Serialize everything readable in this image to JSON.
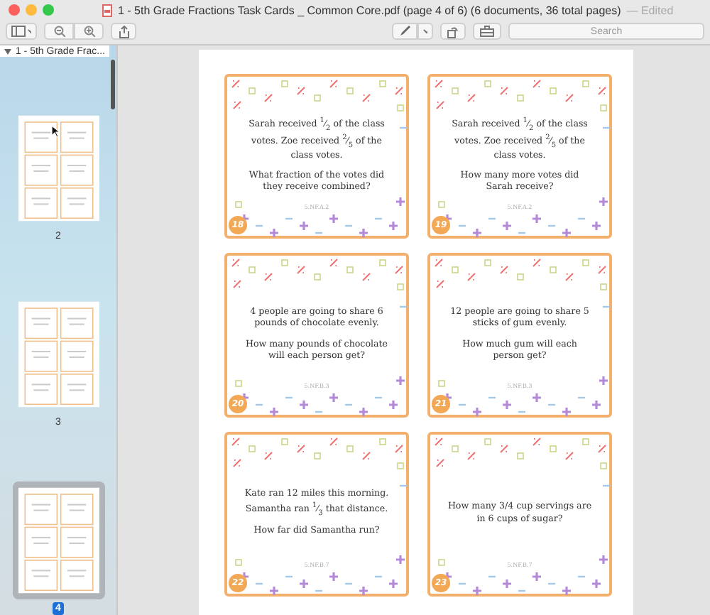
{
  "window": {
    "title": "1 - 5th Grade Fractions Task Cards _ Common Core.pdf (page 4 of 6) (6 documents, 36 total pages)",
    "status": "— Edited"
  },
  "toolbar": {
    "search": {
      "placeholder": "Search"
    }
  },
  "sidebar": {
    "document": {
      "label": "1 - 5th Grade Frac...",
      "expanded": true
    },
    "pages": [
      {
        "label": "2",
        "selected": false
      },
      {
        "label": "3",
        "selected": false
      },
      {
        "label": "4",
        "selected": true
      }
    ]
  },
  "cards": [
    {
      "number": "18",
      "question": "Sarah received $^{1}$⁄$_{2}$ of the class votes. Zoe received $^{2}$⁄$_{5}$ of the class votes.",
      "task": "What fraction of the votes did they receive combined?",
      "standard": "5.NF.A.2"
    },
    {
      "number": "19",
      "question": "Sarah received $^{1}$⁄$_{2}$ of the class votes. Zoe received $^{2}$⁄$_{5}$ of the class votes.",
      "task": "How many more votes did Sarah receive?",
      "standard": "5.NF.A.2"
    },
    {
      "number": "20",
      "question": "4 people are going to share 6 pounds of chocolate evenly.",
      "task": "How many pounds of chocolate will each person get?",
      "standard": "5.NF.B.3"
    },
    {
      "number": "21",
      "question": "12 people are going to share 5 sticks of gum evenly.",
      "task": "How much gum will each person get?",
      "standard": "5.NF.B.3"
    },
    {
      "number": "22",
      "question": "Kate ran 12 miles this morning. Samantha ran $^{1}$⁄$_{3}$ that distance.",
      "task": "How far did Samantha run?",
      "standard": "5.NF.B.7"
    },
    {
      "number": "23",
      "question": "How many 3/4 cup servings are in 6 cups of sugar?",
      "standard": "5.NF.B.7"
    }
  ]
}
